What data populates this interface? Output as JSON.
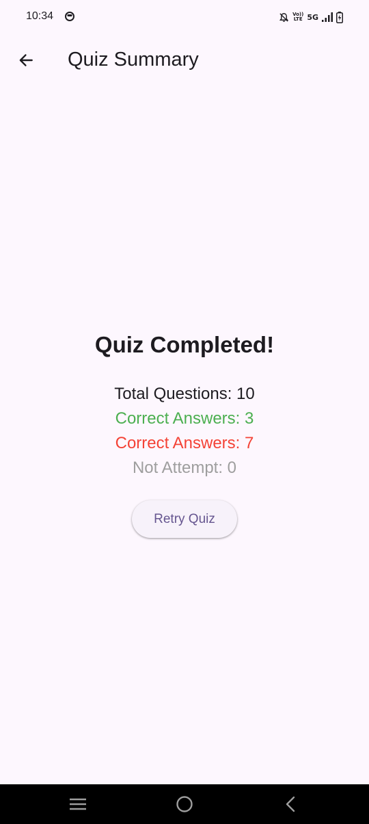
{
  "status_bar": {
    "time": "10:34",
    "network": "5G",
    "volte_top": "Vo))",
    "volte_bottom": "LTE",
    "icons": [
      "app-notification-icon",
      "mute-bell-icon",
      "volte-icon",
      "signal-icon",
      "battery-charging-icon"
    ]
  },
  "app_bar": {
    "back_icon": "arrow-left-icon",
    "title": "Quiz Summary"
  },
  "summary": {
    "heading": "Quiz Completed!",
    "total": "Total Questions: 10",
    "correct": "Correct Answers: 3",
    "incorrect": "Correct Answers: 7",
    "not_attempted": "Not Attempt: 0",
    "retry_label": "Retry Quiz"
  },
  "colors": {
    "background": "#fdf7fe",
    "correct": "#4caf50",
    "incorrect": "#f44336",
    "not_attempted": "#9e9e9e",
    "button_text": "#65558f",
    "nav_bar": "#000000"
  },
  "nav_bar": {
    "icons": [
      "recent-apps-icon",
      "home-icon",
      "back-icon"
    ]
  }
}
